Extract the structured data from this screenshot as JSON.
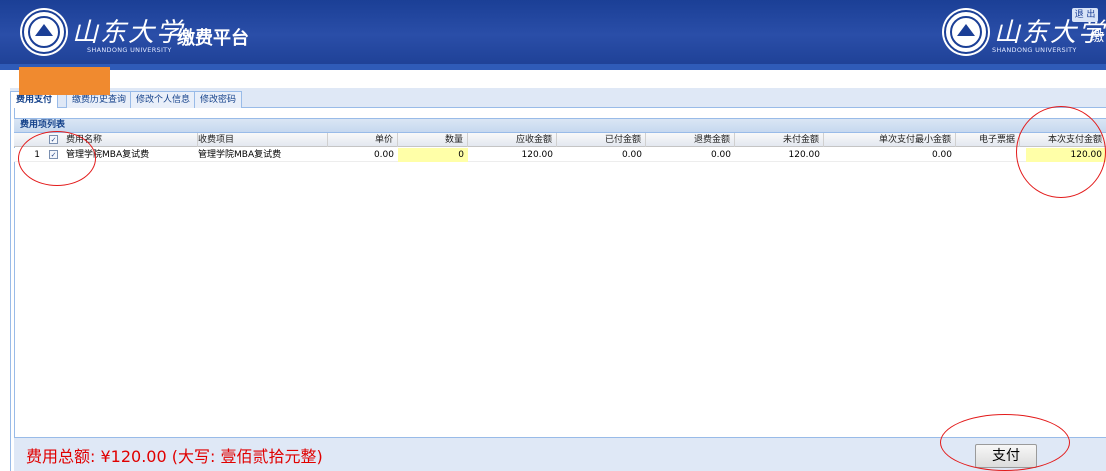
{
  "header": {
    "logo_script": "山东大学",
    "logo_sub": "SHANDONG UNIVERSITY",
    "platform_title": "缴费平台",
    "logout_label": "退 出",
    "right_edge_text": "缴"
  },
  "tabs": [
    {
      "label": "费用支付",
      "active": true
    },
    {
      "label": "缴费历史查询",
      "active": false
    },
    {
      "label": "修改个人信息",
      "active": false
    },
    {
      "label": "修改密码",
      "active": false
    }
  ],
  "panel": {
    "title": "费用项列表"
  },
  "grid": {
    "columns": {
      "fee_name": "费用名称",
      "charge_item": "收费项目",
      "unit_price": "单价",
      "quantity": "数量",
      "receivable": "应收金额",
      "paid": "已付金额",
      "refund": "退费金额",
      "unpaid": "未付金额",
      "min_single": "单次支付最小金额",
      "e_invoice": "电子票据",
      "this_payment": "本次支付金额"
    },
    "rows": [
      {
        "index": "1",
        "checked": "✓",
        "fee_name": "管理学院MBA复试费",
        "charge_item": "管理学院MBA复试费",
        "unit_price": "0.00",
        "quantity": "0",
        "receivable": "120.00",
        "paid": "0.00",
        "refund": "0.00",
        "unpaid": "120.00",
        "min_single": "0.00",
        "e_invoice": "",
        "this_payment": "120.00"
      }
    ],
    "header_check": "✓"
  },
  "footer": {
    "total_text": "费用总额: ¥120.00 (大写: 壹佰贰拾元整)",
    "pay_label": "支付"
  },
  "colors": {
    "header_blue": "#1b3f96",
    "orange_block": "#f08a2f",
    "total_red": "#e00000",
    "annotation_red": "#e31b1b",
    "editable_yellow": "#ffffa8"
  }
}
